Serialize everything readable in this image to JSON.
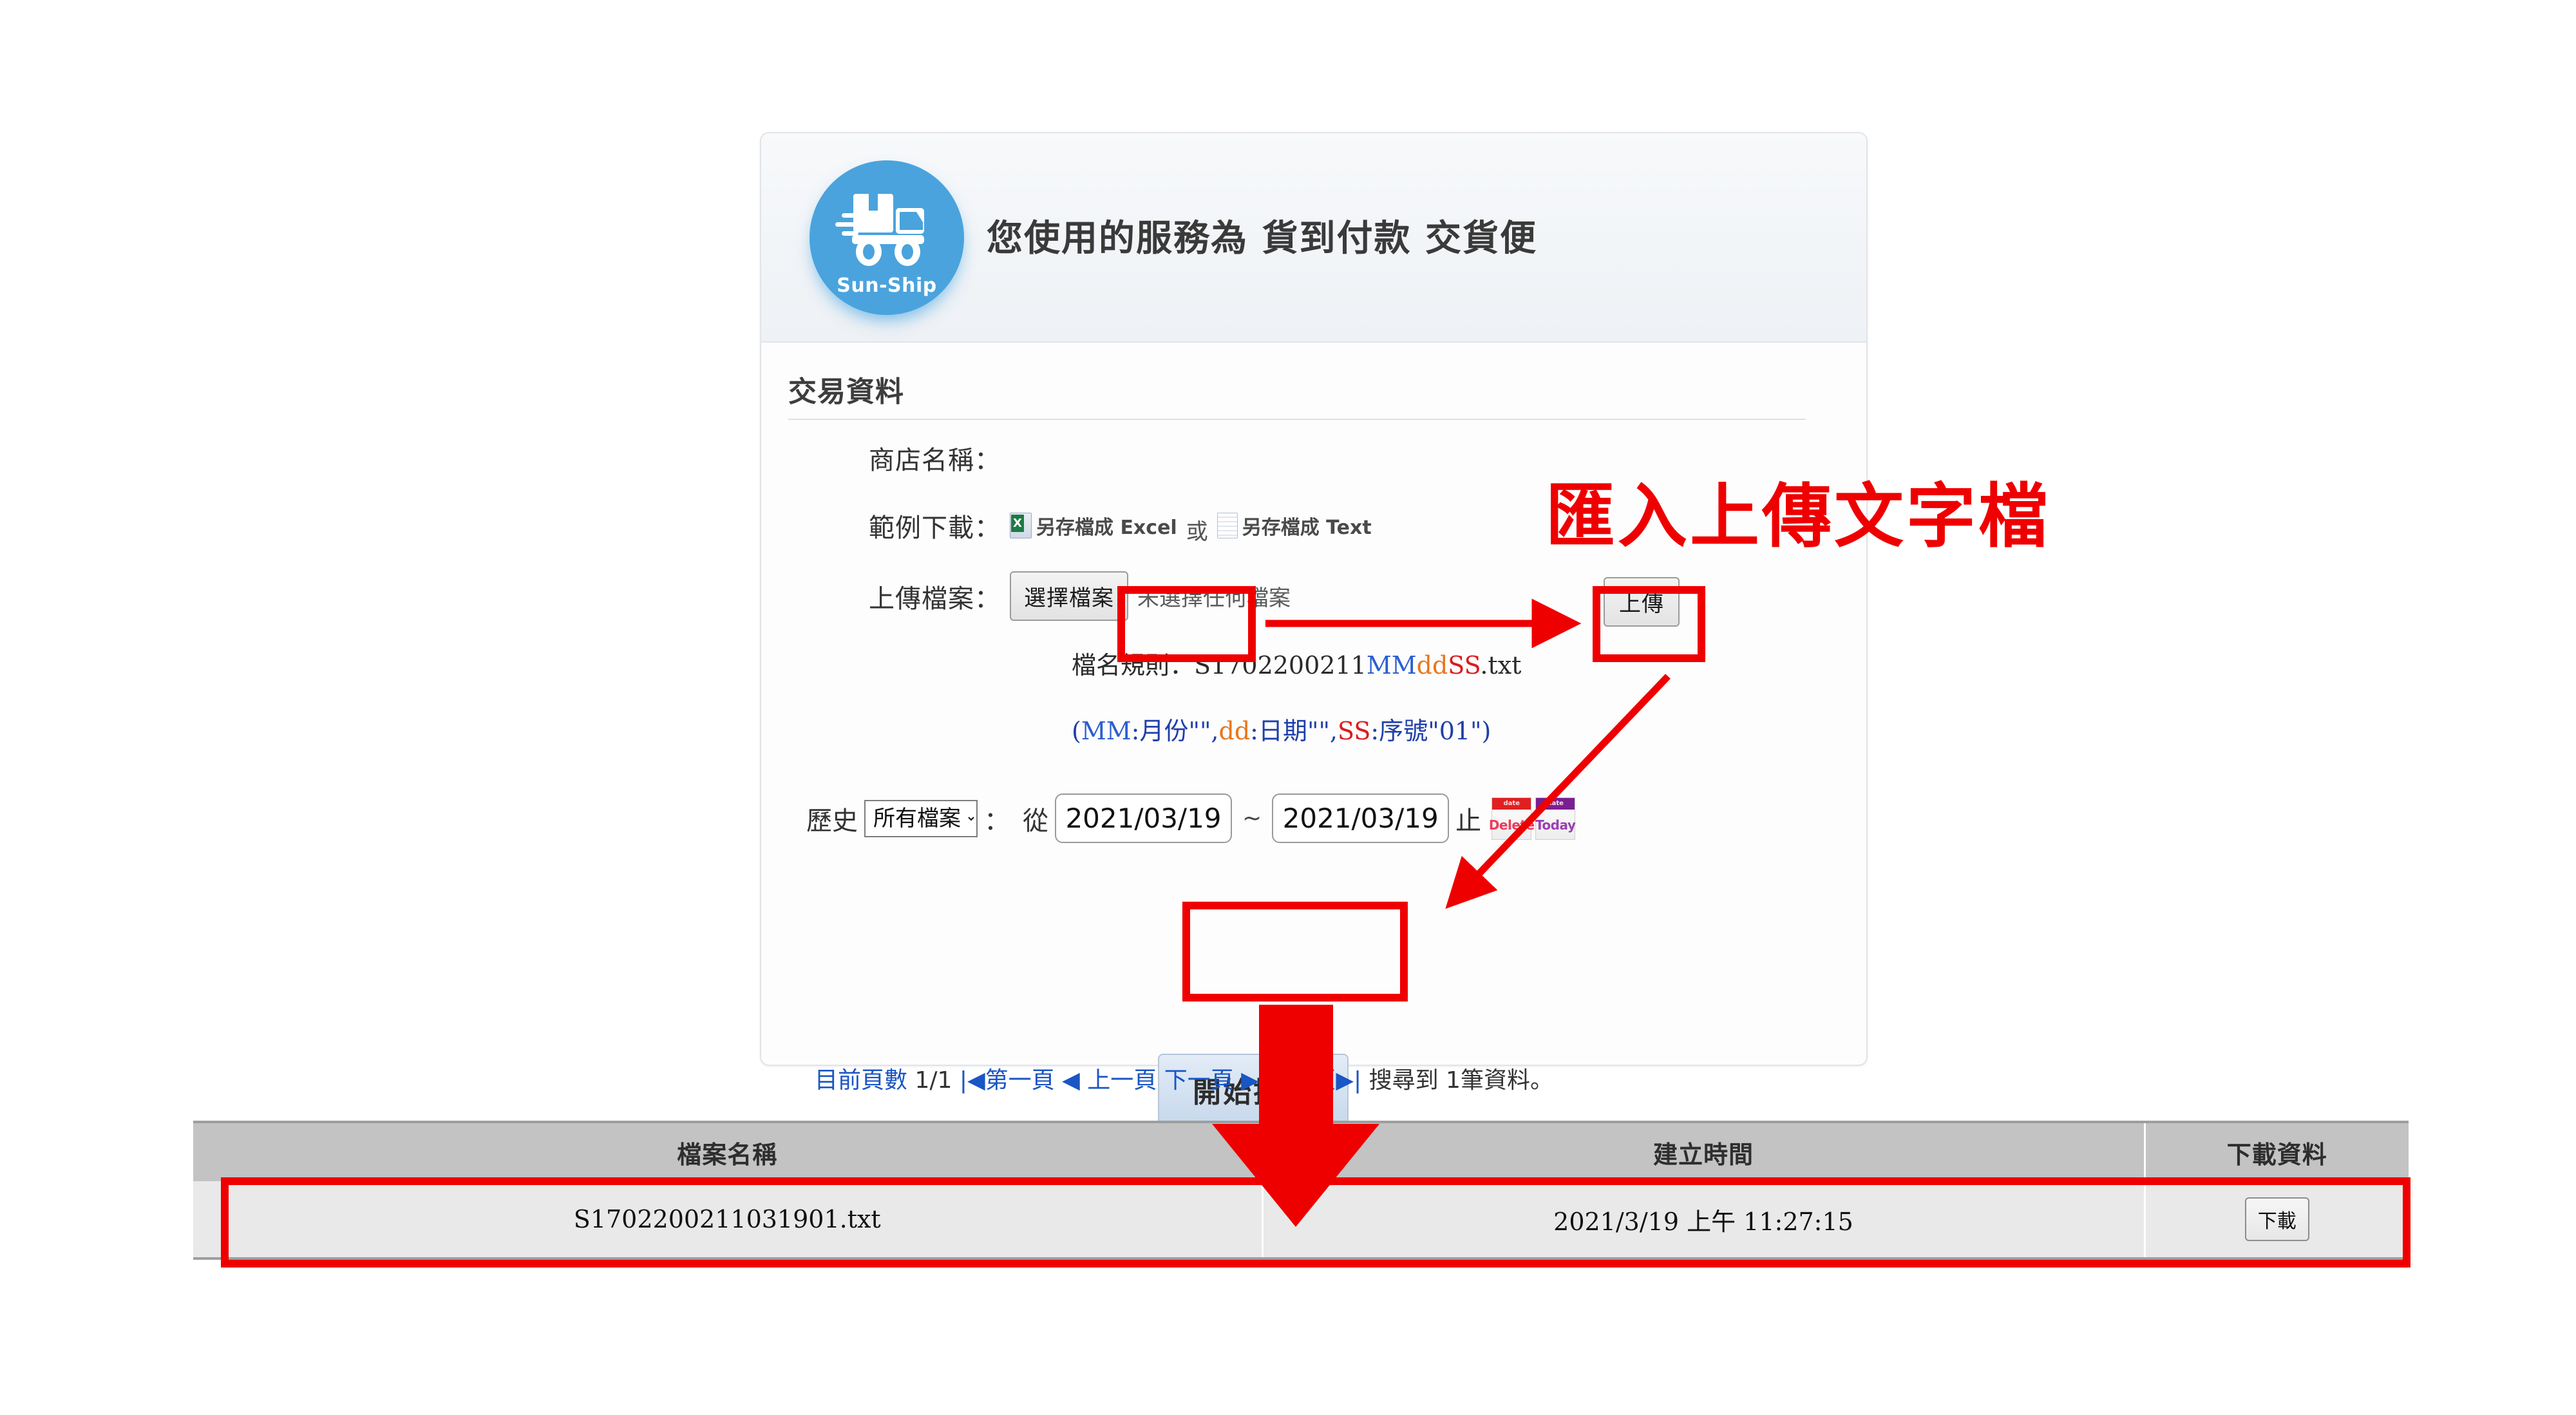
{
  "header": {
    "logo_text": "Sun-Ship",
    "logo_icon": "delivery-truck-icon",
    "title": "您使用的服務為 貨到付款 交貨便"
  },
  "form": {
    "section_title": "交易資料",
    "store_name_label": "商店名稱：",
    "store_name_value": "",
    "sample_download_label": "範例下載：",
    "sample_excel_label": "另存檔成 Excel",
    "sample_or": "或",
    "sample_text_label": "另存檔成 Text",
    "upload_label": "上傳檔案：",
    "choose_file_button": "選擇檔案",
    "no_file_selected": "未選擇任何檔案",
    "upload_button": "上傳",
    "filename_rule_prefix": "檔名規則：S1702200211",
    "filename_rule_mm": "MM",
    "filename_rule_dd": "dd",
    "filename_rule_ss": "SS",
    "filename_rule_suffix": ".txt",
    "legend_open": "(",
    "legend_mm": "MM",
    "legend_mm_desc": ":月份\"\",",
    "legend_dd": "dd",
    "legend_dd_desc": ":日期\"\",",
    "legend_ss": "SS",
    "legend_ss_desc": ":序號\"01\")",
    "history_label": "歷史",
    "history_select_value": "所有檔案",
    "history_select_options": [
      "所有檔案"
    ],
    "history_colon": "：",
    "from_label": "從",
    "date_from": "2021/03/19",
    "date_tilde": "~",
    "date_to": "2021/03/19",
    "to_label": "止",
    "cal_delete_label": "Delete",
    "cal_delete_top": "date",
    "cal_today_label": "Today",
    "cal_today_top": "date",
    "search_button": "開始搜尋"
  },
  "pager": {
    "current_page_label": "目前頁數",
    "current_page": "1/1",
    "first": "|◀第一頁",
    "prev": "◀ 上一頁",
    "next": "下一頁 ▶",
    "last": "最後頁▶|",
    "result_text": "搜尋到 1筆資料。"
  },
  "table": {
    "columns": [
      "檔案名稱",
      "建立時間",
      "下載資料"
    ],
    "rows": [
      {
        "filename": "S1702200211031901.txt",
        "created_at": "2021/3/19 上午 11:27:15",
        "download_button": "下載"
      }
    ]
  },
  "annotations": {
    "import_upload_text": "匯入上傳文字檔",
    "accent_red": "#ef0000"
  }
}
